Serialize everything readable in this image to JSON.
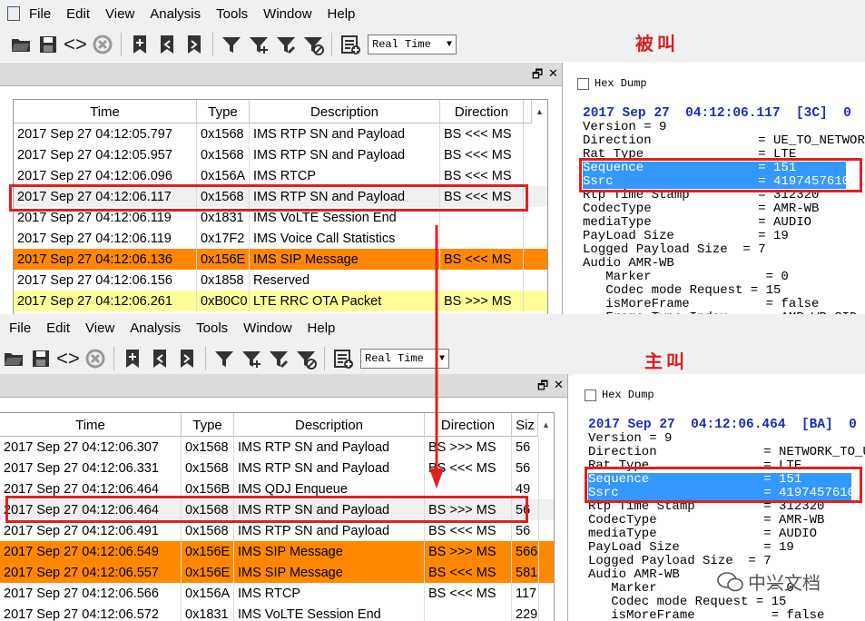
{
  "menu": [
    "File",
    "Edit",
    "View",
    "Analysis",
    "Tools",
    "Window",
    "Help"
  ],
  "toolbar": {
    "realtime_label": "Real Time"
  },
  "callouts": {
    "top": "被叫",
    "bottom": "主叫"
  },
  "top": {
    "hex_dump_label": "Hex Dump",
    "columns": [
      "Time",
      "Type",
      "Description",
      "Direction"
    ],
    "rows": [
      {
        "time": "2017 Sep 27  04:12:05.797",
        "type": "0x1568",
        "desc": "IMS RTP SN and Payload",
        "dir": "BS <<< MS"
      },
      {
        "time": "2017 Sep 27  04:12:05.957",
        "type": "0x1568",
        "desc": "IMS RTP SN and Payload",
        "dir": "BS <<< MS"
      },
      {
        "time": "2017 Sep 27  04:12:06.096",
        "type": "0x156A",
        "desc": "IMS RTCP",
        "dir": "BS <<< MS"
      },
      {
        "time": "2017 Sep 27  04:12:06.117",
        "type": "0x1568",
        "desc": "IMS RTP SN and Payload",
        "dir": "BS <<< MS"
      },
      {
        "time": "2017 Sep 27  04:12:06.119",
        "type": "0x1831",
        "desc": "IMS VoLTE Session End",
        "dir": ""
      },
      {
        "time": "2017 Sep 27  04:12:06.119",
        "type": "0x17F2",
        "desc": "IMS Voice Call Statistics",
        "dir": ""
      },
      {
        "time": "2017 Sep 27  04:12:06.136",
        "type": "0x156E",
        "desc": "IMS SIP Message",
        "dir": "BS <<< MS"
      },
      {
        "time": "2017 Sep 27  04:12:06.156",
        "type": "0x1858",
        "desc": "Reserved",
        "dir": ""
      },
      {
        "time": "2017 Sep 27  04:12:06.261",
        "type": "0xB0C0",
        "desc": "LTE RRC OTA Packet",
        "dir": "BS >>> MS"
      }
    ],
    "detail_title": "2017 Sep 27  04:12:06.117  [3C]  0",
    "detail_lines": [
      "Version = 9",
      "Direction              = UE_TO_NETWOR",
      "Rat Type               = LTE",
      "Sequence               = 151",
      "Ssrc                   = 4197457610",
      "Rtp Time Stamp         = 312320",
      "CodecType              = AMR-WB",
      "mediaType              = AUDIO",
      "PayLoad Size           = 19",
      "Logged Payload Size  = 7",
      "Audio AMR-WB",
      "   Marker               = 0",
      "   Codec mode Request = 15",
      "   isMoreFrame          = false",
      "   Frame Type Index     = AMR_WB_SID"
    ]
  },
  "bottom": {
    "hex_dump_label": "Hex Dump",
    "columns": [
      "Time",
      "Type",
      "Description",
      "Direction",
      "Siz"
    ],
    "rows": [
      {
        "time": "2017 Sep 27  04:12:06.307",
        "type": "0x1568",
        "desc": "IMS RTP SN and Payload",
        "dir": "BS >>> MS",
        "size": "56"
      },
      {
        "time": "2017 Sep 27  04:12:06.331",
        "type": "0x1568",
        "desc": "IMS RTP SN and Payload",
        "dir": "BS <<< MS",
        "size": "56"
      },
      {
        "time": "2017 Sep 27  04:12:06.464",
        "type": "0x156B",
        "desc": "IMS QDJ Enqueue",
        "dir": "",
        "size": "49"
      },
      {
        "time": "2017 Sep 27  04:12:06.464",
        "type": "0x1568",
        "desc": "IMS RTP SN and Payload",
        "dir": "BS >>> MS",
        "size": "56"
      },
      {
        "time": "2017 Sep 27  04:12:06.491",
        "type": "0x1568",
        "desc": "IMS RTP SN and Payload",
        "dir": "BS <<< MS",
        "size": "56"
      },
      {
        "time": "2017 Sep 27  04:12:06.549",
        "type": "0x156E",
        "desc": "IMS SIP Message",
        "dir": "BS >>> MS",
        "size": "566"
      },
      {
        "time": "2017 Sep 27  04:12:06.557",
        "type": "0x156E",
        "desc": "IMS SIP Message",
        "dir": "BS <<< MS",
        "size": "581"
      },
      {
        "time": "2017 Sep 27  04:12:06.566",
        "type": "0x156A",
        "desc": "IMS RTCP",
        "dir": "BS <<< MS",
        "size": "117"
      },
      {
        "time": "2017 Sep 27  04:12:06.572",
        "type": "0x1831",
        "desc": "IMS VoLTE Session End",
        "dir": "",
        "size": "229"
      }
    ],
    "detail_title": "2017 Sep 27  04:12:06.464  [BA]  0",
    "detail_lines": [
      "Version = 9",
      "Direction              = NETWORK_TO_U",
      "Rat Type               = LTE",
      "Sequence               = 151",
      "Ssrc                   = 4197457610",
      "Rtp Time Stamp         = 312320",
      "CodecType              = AMR-WB",
      "mediaType              = AUDIO",
      "PayLoad Size           = 19",
      "Logged Payload Size  = 7",
      "Audio AMR-WB",
      "   Marker               = 0",
      "   Codec mode Request = 15",
      "   isMoreFrame          = false"
    ]
  },
  "watermark": "中兴文档",
  "colors": {
    "sip_row": "#ff8800",
    "rrc_row": "#ffff99",
    "selected_row": "#f0f0f0",
    "highlight": "#3399ff",
    "annotation_red": "#e02020",
    "detail_title": "#1b2ebd"
  }
}
